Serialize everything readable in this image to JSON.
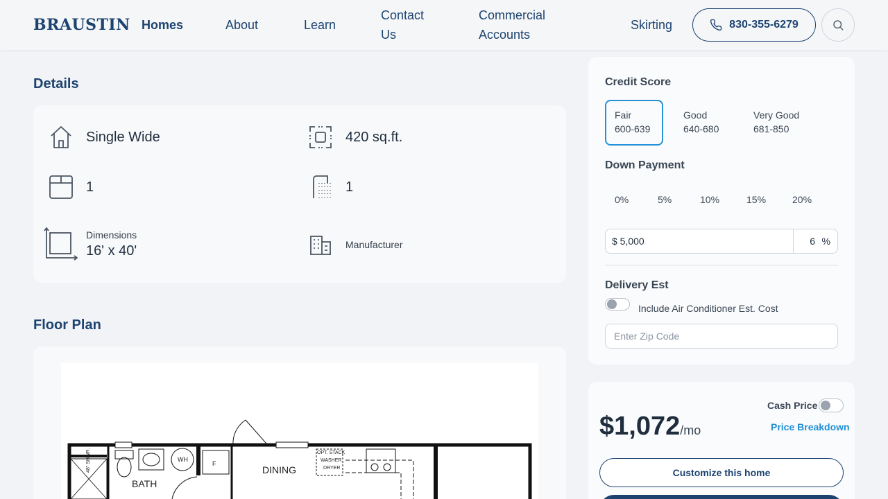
{
  "header": {
    "logo": "BRAUSTIN",
    "nav": {
      "homes": "Homes",
      "about": "About",
      "learn": "Learn",
      "contact_1": "Contact",
      "contact_2": "Us",
      "commercial_1": "Commercial",
      "commercial_2": "Accounts",
      "skirting": "Skirting"
    },
    "phone": "830-355-6279",
    "icons": {
      "phone": "phone-icon",
      "search": "search-icon"
    }
  },
  "details": {
    "title": "Details",
    "type": "Single Wide",
    "area": "420 sq.ft.",
    "bedrooms": "1",
    "bathrooms": "1",
    "dimensions_label": "Dimensions",
    "dimensions_value": "16' x 40'",
    "manufacturer_label": "Manufacturer",
    "icons": {
      "type": "house-icon",
      "area": "area-icon",
      "bedrooms": "bed-icon",
      "bathrooms": "shower-icon",
      "dimensions": "dimensions-icon",
      "manufacturer": "building-icon"
    }
  },
  "floor_plan": {
    "title": "Floor Plan",
    "labels": {
      "dining": "DINING",
      "bath": "BATH",
      "wh": "WH",
      "f": "F",
      "opt": "OPT. STACK",
      "washer": "WASHER",
      "dryer": "DRYER",
      "shwr": "48\" SHWR."
    }
  },
  "calculator": {
    "credit_score_label": "Credit Score",
    "credit_scores": [
      {
        "name": "Fair",
        "range": "600-639",
        "selected": true
      },
      {
        "name": "Good",
        "range": "640-680",
        "selected": false
      },
      {
        "name": "Very Good",
        "range": "681-850",
        "selected": false
      }
    ],
    "down_payment_label": "Down Payment",
    "down_payment_options": [
      "0%",
      "5%",
      "10%",
      "15%",
      "20%"
    ],
    "down_payment_amount": "$ 5,000",
    "down_payment_percent": "6",
    "percent_sign": "%",
    "delivery_label": "Delivery Est",
    "ac_toggle_label": "Include Air Conditioner Est. Cost",
    "ac_toggle_on": false,
    "zip_placeholder": "Enter Zip Code"
  },
  "pricing": {
    "cash_price_label": "Cash Price",
    "cash_price_on": false,
    "monthly_price": "$1,072",
    "monthly_suffix": "/mo",
    "breakdown_link": "Price Breakdown",
    "customize_button": "Customize this home"
  },
  "colors": {
    "brand": "#1c4370",
    "accent": "#1f8fd6",
    "selected_border": "#2491d8",
    "background": "#f2f3f6"
  }
}
